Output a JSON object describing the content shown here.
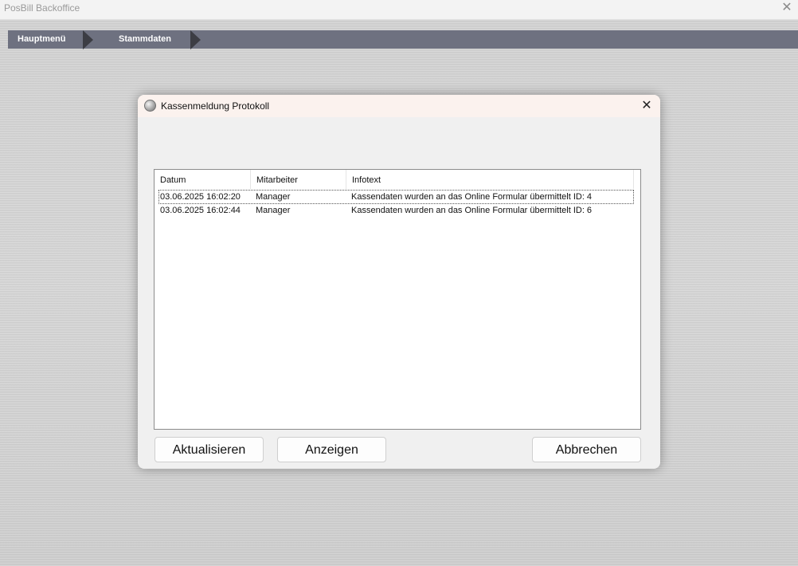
{
  "window": {
    "title": "PosBill Backoffice",
    "close_glyph": "✕"
  },
  "breadcrumb": {
    "items": [
      "Hauptmenü",
      "Stammdaten"
    ]
  },
  "dialog": {
    "title": "Kassenmeldung Protokoll",
    "close_glyph": "✕",
    "icon": "app-orb-icon",
    "list": {
      "columns": [
        "Datum",
        "Mitarbeiter",
        "Infotext"
      ],
      "rows": [
        {
          "datum": "03.06.2025 16:02:20",
          "mitarbeiter": "Manager",
          "infotext": "Kassendaten wurden an das Online Formular übermittelt ID: 4"
        },
        {
          "datum": "03.06.2025 16:02:44",
          "mitarbeiter": "Manager",
          "infotext": "Kassendaten wurden an das Online Formular übermittelt ID: 6"
        }
      ]
    },
    "buttons": {
      "refresh": "Aktualisieren",
      "show": "Anzeigen",
      "cancel": "Abbrechen"
    }
  }
}
